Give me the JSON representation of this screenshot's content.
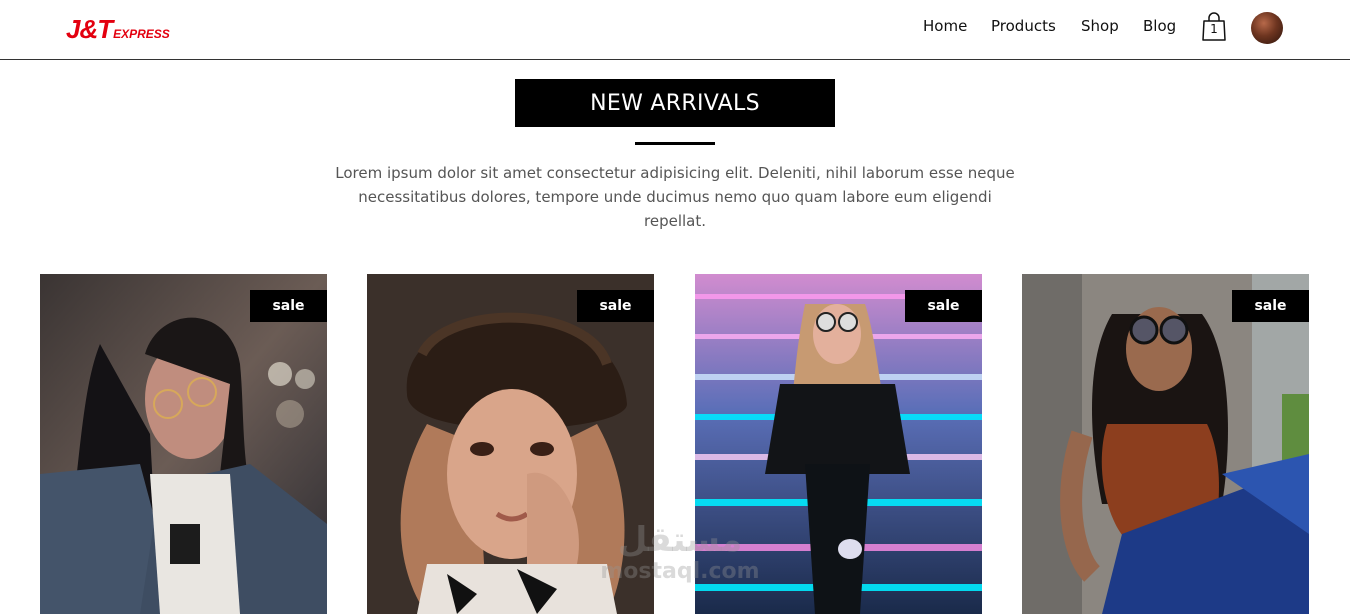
{
  "header": {
    "logo_main": "J&T",
    "logo_sub": "EXPRESS",
    "nav": [
      "Home",
      "Products",
      "Shop",
      "Blog"
    ],
    "cart_count": "1",
    "cart_icon": "shopping-bag-icon",
    "avatar": "user-avatar"
  },
  "section": {
    "title": "NEW ARRIVALS",
    "description": "Lorem ipsum dolor sit amet consectetur adipisicing elit. Deleniti, nihil laborum esse neque necessitatibus dolores, tempore unde ducimus nemo quo quam labore eum eligendi repellat."
  },
  "products": [
    {
      "badge": "sale"
    },
    {
      "badge": "sale"
    },
    {
      "badge": "sale"
    },
    {
      "badge": "sale"
    }
  ],
  "watermark": {
    "arabic": "مستقل",
    "latin": "mostaql.com"
  },
  "colors": {
    "brand": "#e3000f",
    "accent": "#000000"
  }
}
